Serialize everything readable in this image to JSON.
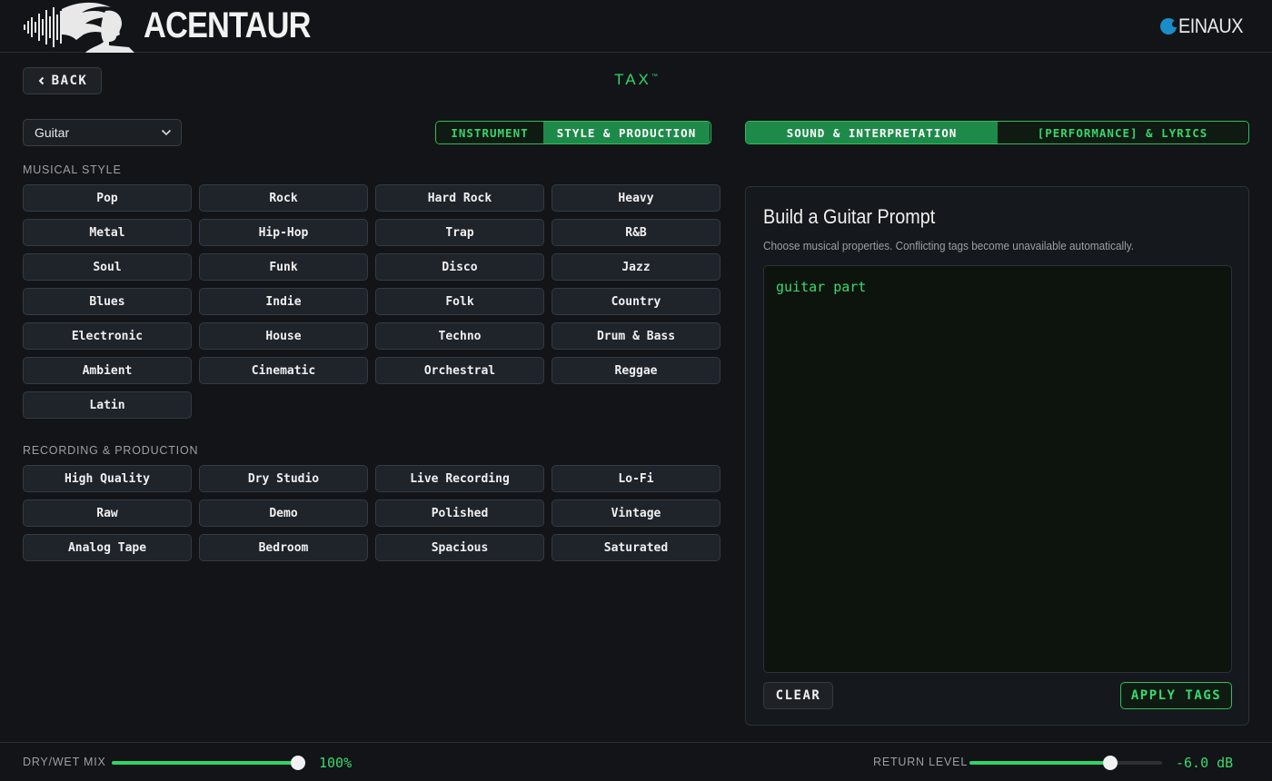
{
  "header": {
    "brand": "ACENTAUR",
    "partner": "EINAUX",
    "logo_icon": "centaur-soundwave-logo",
    "partner_icon": "partner-dot-icon"
  },
  "nav": {
    "back_label": "BACK",
    "title": "TAX",
    "title_mark": "™"
  },
  "instrument_select": {
    "value": "Guitar"
  },
  "tabs_left": [
    {
      "label": "INSTRUMENT",
      "active": false
    },
    {
      "label": "STYLE & PRODUCTION",
      "active": true
    }
  ],
  "tabs_right": [
    {
      "label": "SOUND & INTERPRETATION",
      "active": true
    },
    {
      "label": "[PERFORMANCE] & LYRICS",
      "active": false
    }
  ],
  "musical_style": {
    "label": "MUSICAL STYLE",
    "tags": [
      "Pop",
      "Rock",
      "Hard Rock",
      "Heavy",
      "Metal",
      "Hip-Hop",
      "Trap",
      "R&B",
      "Soul",
      "Funk",
      "Disco",
      "Jazz",
      "Blues",
      "Indie",
      "Folk",
      "Country",
      "Electronic",
      "House",
      "Techno",
      "Drum & Bass",
      "Ambient",
      "Cinematic",
      "Orchestral",
      "Reggae",
      "Latin"
    ]
  },
  "recording": {
    "label": "RECORDING & PRODUCTION",
    "tags": [
      "High Quality",
      "Dry Studio",
      "Live Recording",
      "Lo-Fi",
      "Raw",
      "Demo",
      "Polished",
      "Vintage",
      "Analog Tape",
      "Bedroom",
      "Spacious",
      "Saturated"
    ]
  },
  "prompt_panel": {
    "title": "Build a Guitar Prompt",
    "subtitle": "Choose musical properties. Conflicting tags become unavailable automatically.",
    "prompt_text": "guitar part",
    "clear_label": "CLEAR",
    "apply_label": "APPLY TAGS"
  },
  "footer": {
    "dry_wet_label": "DRY/WET MIX",
    "dry_wet_value": "100%",
    "dry_wet_fraction": 1.0,
    "return_label": "RETURN LEVEL",
    "return_value": "-6.0 dB",
    "return_fraction": 0.73
  },
  "colors": {
    "accent_green": "#2fd565",
    "active_tab": "#1e8a4a",
    "background": "#121417"
  }
}
